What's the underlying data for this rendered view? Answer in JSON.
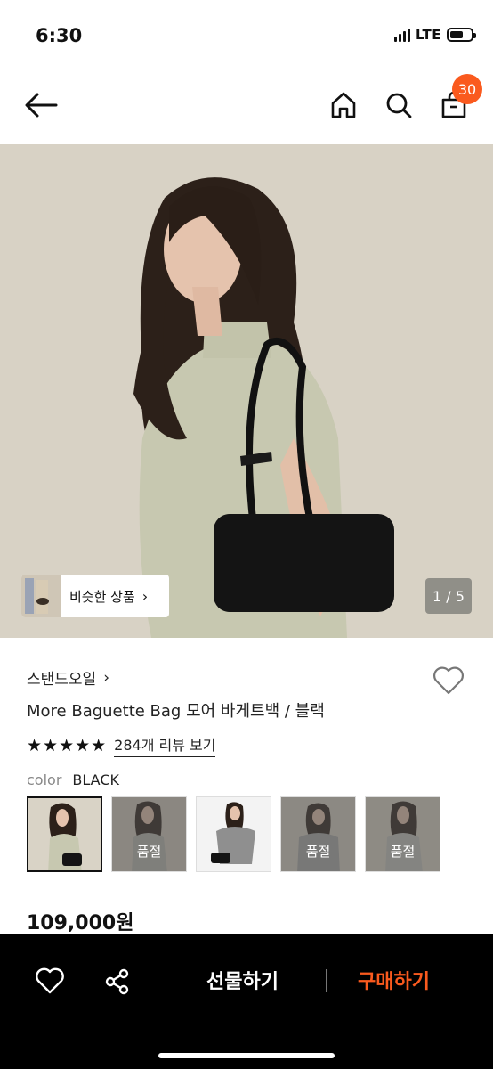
{
  "status_bar": {
    "time": "6:30",
    "network": "LTE",
    "battery_level": 0.65
  },
  "nav": {
    "cart_count": "30"
  },
  "gallery": {
    "similar_label": "비슷한 상품",
    "page_indicator": "1 / 5"
  },
  "product": {
    "brand": "스탠드오일",
    "name": "More Baguette Bag 모어 바게트백 / 블랙",
    "rating_stars": "★★★★★",
    "review_link": "284개 리뷰 보기",
    "color_label": "color",
    "color_value": "BLACK",
    "price": "109,000원"
  },
  "swatches": [
    {
      "state": "selected",
      "label": ""
    },
    {
      "state": "soldout",
      "label": "품절"
    },
    {
      "state": "available",
      "label": ""
    },
    {
      "state": "soldout",
      "label": "품절"
    },
    {
      "state": "soldout",
      "label": "품절"
    }
  ],
  "bottom_bar": {
    "gift_label": "선물하기",
    "buy_label": "구매하기"
  },
  "colors": {
    "accent": "#fa5a1e",
    "bottom_bar_bg": "#000000"
  }
}
